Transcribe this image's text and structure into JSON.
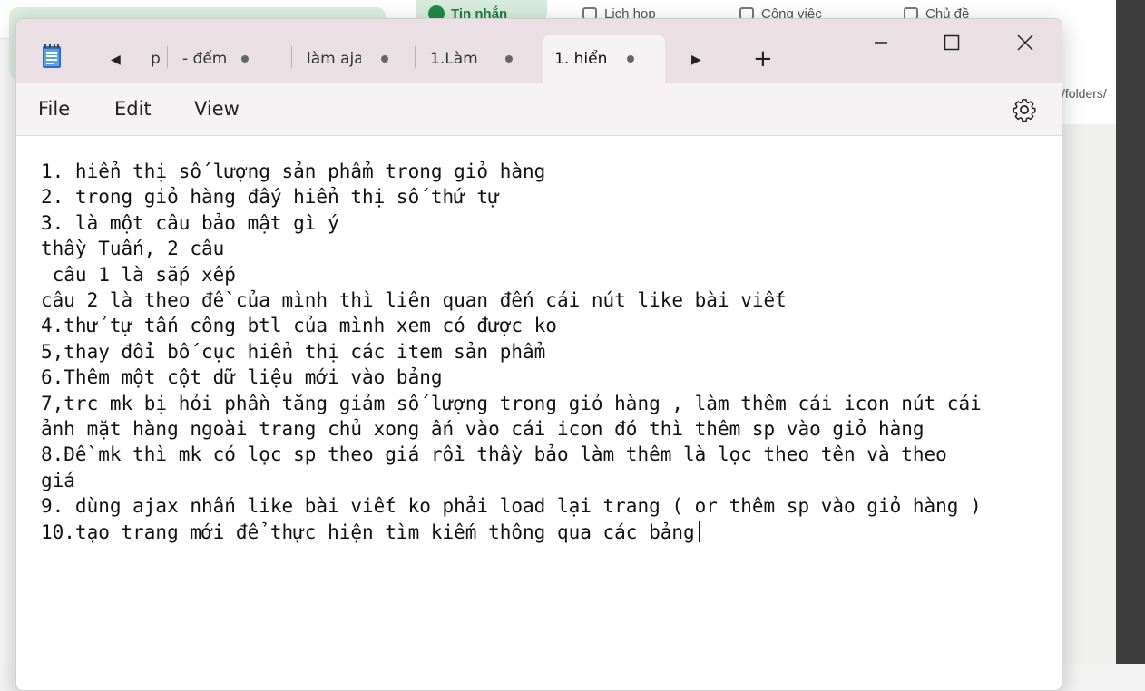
{
  "background_app": {
    "tabs": [
      {
        "label": "Tin nhắn",
        "active": true
      },
      {
        "label": "Lịch họp"
      },
      {
        "label": "Công việc"
      },
      {
        "label": "Chủ đề"
      }
    ],
    "path_fragment": "/folders/"
  },
  "notepad": {
    "tabs": [
      {
        "label": "p",
        "unsaved": false
      },
      {
        "label": "- đếm",
        "unsaved": true
      },
      {
        "label": "làm aja",
        "unsaved": true
      },
      {
        "label": "1.Làm",
        "unsaved": true
      },
      {
        "label": "1. hiển",
        "unsaved": true,
        "active": true
      }
    ],
    "menu": {
      "file": "File",
      "edit": "Edit",
      "view": "View"
    },
    "icons": {
      "app": "notepad-icon",
      "scroll_left": "triangle-left-icon",
      "scroll_right": "triangle-right-icon",
      "new_tab": "plus-icon",
      "settings": "gear-icon",
      "minimize": "minimize-icon",
      "maximize": "maximize-icon",
      "close": "close-icon"
    },
    "lines": [
      "1. hiển thị số lượng sản phẩm trong giỏ hàng",
      "2. trong giỏ hàng đấy hiển thị số thứ tự",
      "3. là một câu bảo mật gì ý",
      "thầy Tuấn, 2 câu",
      " câu 1 là sắp xếp",
      "câu 2 là theo đề của mình thì liên quan đến cái nút like bài viết",
      "4.thử tự tấn công btl của mình xem có được ko",
      "5,thay đổi bố cục hiển thị các item sản phẩm",
      "6.Thêm một cột dữ liệu mới vào bảng",
      "7,trc mk bị hỏi phần tăng giảm số lượng trong giỏ hàng , làm thêm cái icon nút cái",
      "ảnh mặt hàng ngoài trang chủ xong ấn vào cái icon đó thì thêm sp vào giỏ hàng",
      "8.Đề mk thì mk có lọc sp theo giá rồi thầy bảo làm thêm là lọc theo tên và theo",
      "giá",
      "9. dùng ajax nhấn like bài viết ko phải load lại trang ( or thêm sp vào giỏ hàng )",
      "10.tạo trang mới để thực hiện tìm kiếm thông qua các bảng"
    ],
    "colors": {
      "titlebar": "#eadfe2",
      "menubar": "#f7f3f4",
      "editor_bg": "#ffffff",
      "text": "#111111"
    }
  }
}
